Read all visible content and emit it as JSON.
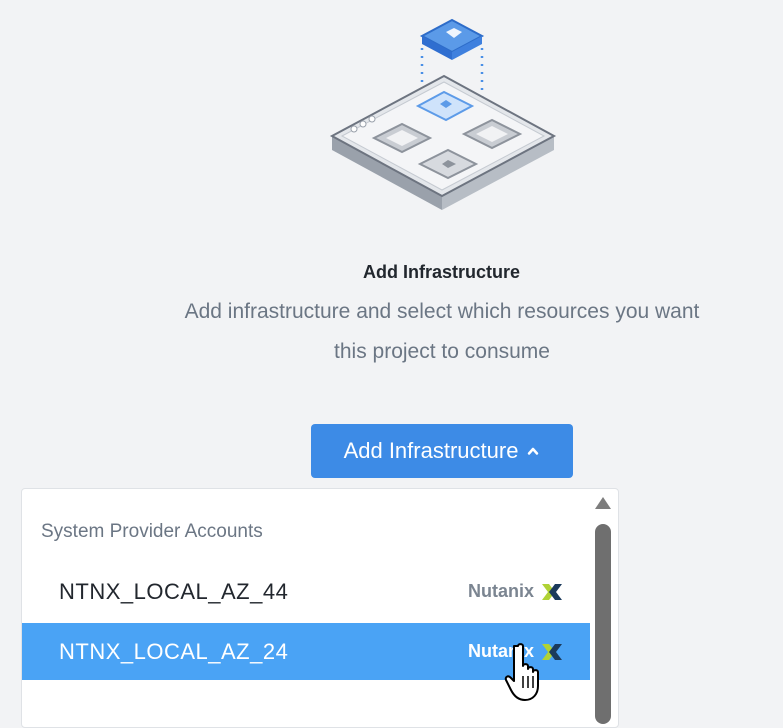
{
  "empty_state": {
    "illustration_icon": "infrastructure-grid-illustration",
    "title": "Add Infrastructure",
    "description": "Add infrastructure and select which resources you want this project to consume"
  },
  "add_button": {
    "label": "Add Infrastructure",
    "icon": "chevron-up-icon"
  },
  "dropdown": {
    "group_label": "System Provider Accounts",
    "items": [
      {
        "name": "NTNX_LOCAL_AZ_44",
        "provider": "Nutanix",
        "provider_icon": "nutanix-x-logo",
        "selected": false
      },
      {
        "name": "NTNX_LOCAL_AZ_24",
        "provider": "Nutanix",
        "provider_icon": "nutanix-x-logo",
        "selected": true
      }
    ]
  },
  "colors": {
    "background": "#f2f3f5",
    "button": "#3d8be6",
    "highlight": "#4aa3f5",
    "nutanix_green": "#b0d235",
    "nutanix_navy": "#1b3a5c"
  }
}
